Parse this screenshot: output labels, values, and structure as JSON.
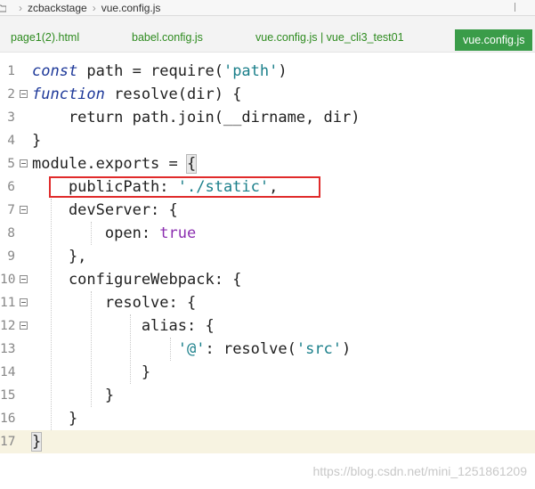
{
  "breadcrumb": {
    "items": [
      "zcbackstage",
      "vue.config.js"
    ]
  },
  "tabs": [
    {
      "label": "page1(2).html"
    },
    {
      "label": "babel.config.js"
    },
    {
      "label": "vue.config.js | vue_cli3_test01"
    },
    {
      "label": "vue.config.js",
      "active": true
    }
  ],
  "editor": {
    "line_numbers": [
      "1",
      "2",
      "3",
      "4",
      "5",
      "6",
      "7",
      "8",
      "9",
      "10",
      "11",
      "12",
      "13",
      "14",
      "15",
      "16",
      "17"
    ],
    "current_line": 17
  },
  "watermark": "https://blog.csdn.net/mini_1251861209",
  "colors": {
    "accent_tab": "#3a9c49",
    "highlight_box": "#e02b2b",
    "tab_text": "#2e8b1f"
  }
}
